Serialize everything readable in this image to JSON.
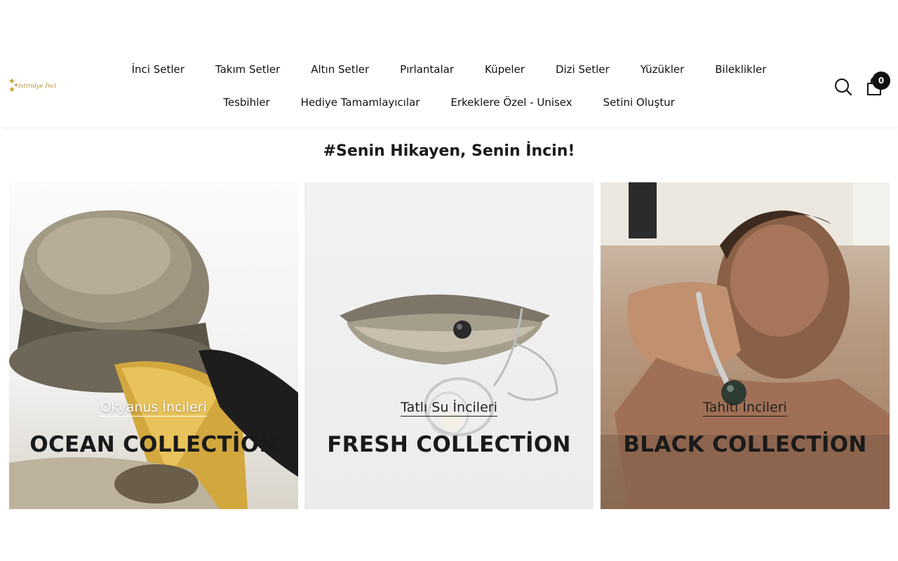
{
  "header": {
    "logo_text": "Istiridye İnci",
    "nav_row1": [
      "İnci Setler",
      "Takım Setler",
      "Altın Setler",
      "Pırlantalar",
      "Küpeler",
      "Dizi Setler",
      "Yüzükler",
      "Bileklikler"
    ],
    "nav_row2": [
      "Tesbihler",
      "Hediye Tamamlayıcılar",
      "Erkeklere Özel - Unisex",
      "Setini Oluştur"
    ],
    "search_icon": "search-icon",
    "cart_icon": "shopping-bag-icon",
    "cart_count": "0"
  },
  "main": {
    "title": "#Senin Hikayen, Senin İncin!",
    "cards": [
      {
        "subtitle": "Okyanus İncileri",
        "title": "OCEAN COLLECTİON"
      },
      {
        "subtitle": "Tatlı Su İncileri",
        "title": "FRESH COLLECTİON"
      },
      {
        "subtitle": "Tahiti İncileri",
        "title": "BLACK COLLECTİON"
      }
    ]
  },
  "colors": {
    "highlight": "#f4dcd6",
    "text": "#1a1a1a",
    "gold": "#b08a2a"
  }
}
